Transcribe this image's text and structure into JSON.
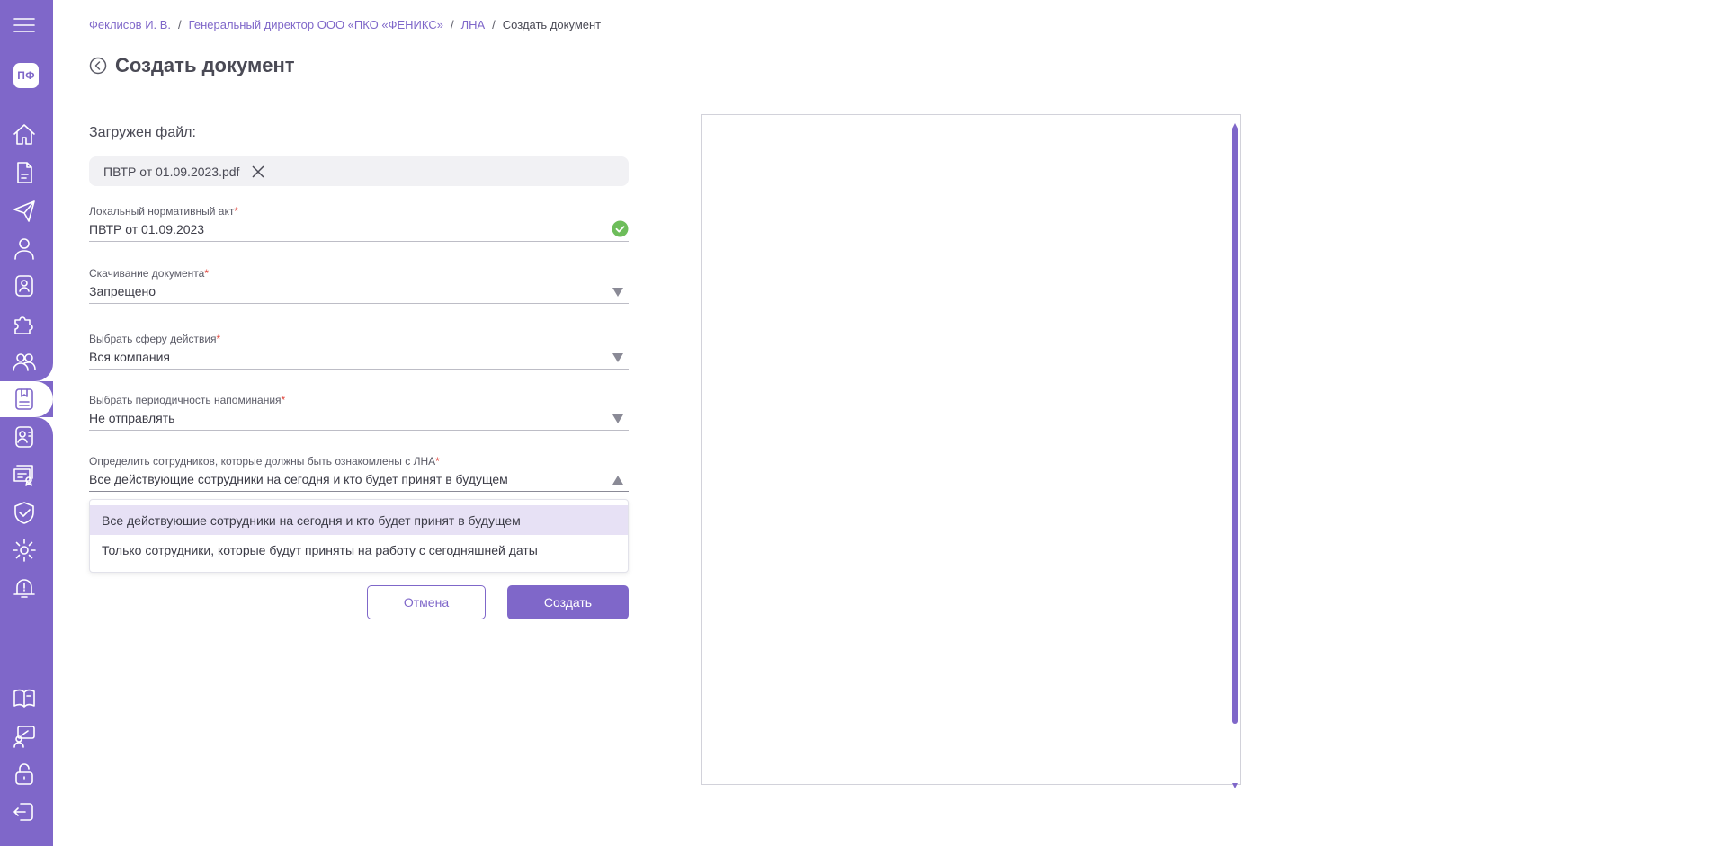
{
  "sidebar": {
    "avatar_initials": "ПФ",
    "accent_color": "#7f67c9",
    "items": [
      {
        "icon": "menu-icon"
      },
      {
        "icon": "home-icon"
      },
      {
        "icon": "document-icon"
      },
      {
        "icon": "send-icon"
      },
      {
        "icon": "user-icon"
      },
      {
        "icon": "profile-badge-icon"
      },
      {
        "icon": "puzzle-icon"
      },
      {
        "icon": "team-icon"
      },
      {
        "icon": "bookmark-document-icon",
        "active": true
      },
      {
        "icon": "contact-card-icon"
      },
      {
        "icon": "certificate-icon"
      },
      {
        "icon": "shield-check-icon"
      },
      {
        "icon": "gear-icon"
      },
      {
        "icon": "alert-bell-icon"
      },
      {
        "icon": "book-icon"
      },
      {
        "icon": "presentation-icon"
      },
      {
        "icon": "lock-icon"
      },
      {
        "icon": "logout-icon"
      }
    ]
  },
  "breadcrumb": {
    "items": [
      "Феклисов И. В.",
      "Генеральный директор ООО «ПКО «ФЕНИКС»",
      "ЛНА"
    ],
    "current": "Создать документ"
  },
  "page": {
    "title": "Создать документ"
  },
  "form": {
    "uploaded_label": "Загружен файл:",
    "file_name": "ПВТР от 01.09.2023.pdf",
    "required_mark": "*",
    "fields": [
      {
        "label": "Локальный нормативный акт",
        "value": "ПВТР от 01.09.2023",
        "status": "valid"
      },
      {
        "label": "Скачивание документа",
        "value": "Запрещено"
      },
      {
        "label": "Выбрать сферу действия",
        "value": "Вся компания"
      },
      {
        "label": "Выбрать периодичность напоминания",
        "value": "Не отправлять"
      },
      {
        "label": "Определить сотрудников, которые должны быть ознакомлены с ЛНА",
        "value": "Все действующие сотрудники на сегодня и кто будет принят в будущем",
        "expanded": true
      }
    ],
    "dropdown_options": [
      "Все действующие сотрудники на сегодня и кто будет принят в будущем",
      "Только сотрудники, которые будут приняты на работу с сегодняшней даты"
    ],
    "cancel_label": "Отмена",
    "create_label": "Создать"
  },
  "colors": {
    "accent": "#7f67c9",
    "valid": "#6dbd5a",
    "required": "#e0433a"
  }
}
